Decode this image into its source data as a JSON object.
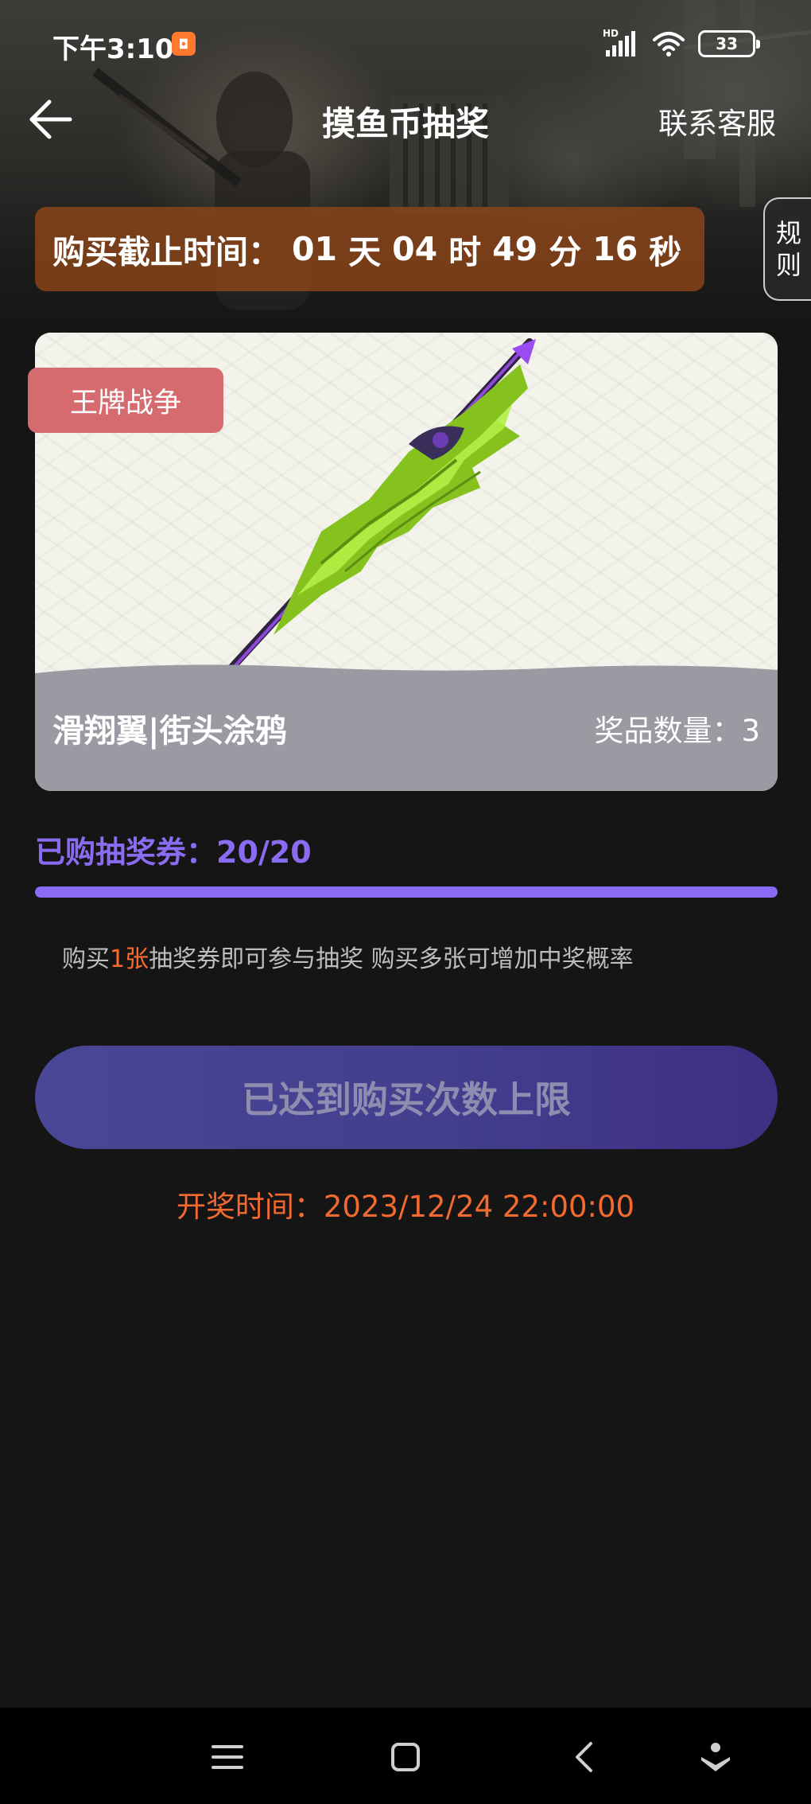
{
  "status_bar": {
    "time": "下午3:10",
    "network_label": "HD",
    "battery": "33"
  },
  "nav": {
    "title": "摸鱼币抽奖",
    "contact": "联系客服"
  },
  "countdown": {
    "label": "购买截止时间：",
    "days": "01",
    "days_unit": "天",
    "hours": "04",
    "hours_unit": "时",
    "minutes": "49",
    "minutes_unit": "分",
    "seconds": "16",
    "seconds_unit": "秒"
  },
  "rules_tab": {
    "line1": "规",
    "line2": "则"
  },
  "prize": {
    "game_tag": "王牌战争",
    "name": "滑翔翼|街头涂鸦",
    "quantity_text": "奖品数量：3"
  },
  "tickets": {
    "label": "已购抽奖券：20/20",
    "purchased": 20,
    "limit": 20
  },
  "hint": {
    "before": "购买",
    "highlight": "1张",
    "after": "抽奖券即可参与抽奖 购买多张可增加中奖概率"
  },
  "action_button": {
    "label": "已达到购买次数上限"
  },
  "draw_time": "开奖时间：2023/12/24 22:00:00",
  "colors": {
    "accent_purple": "#8b6bf4",
    "highlight_orange": "#f26a30",
    "tag_red": "#d56b6e",
    "countdown_bg": "#8b4518"
  },
  "icons": {
    "back": "arrow-left-icon",
    "menu": "menu-icon",
    "home": "home-square-icon",
    "back_nav": "chevron-left-icon",
    "assistant": "assistant-icon"
  }
}
